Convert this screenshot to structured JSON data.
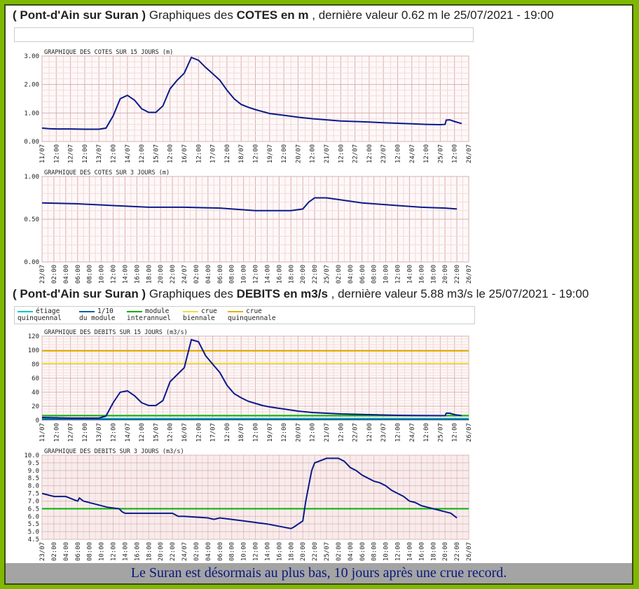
{
  "header_cotes": {
    "station": "( Pont-d'Ain sur Suran )",
    "mid": " Graphiques des ",
    "bold": "COTES en m",
    "tail": " , dernière valeur 0.62 m le 25/07/2021 - 19:00"
  },
  "header_debits": {
    "station": "( Pont-d'Ain sur Suran )",
    "mid": " Graphiques des ",
    "bold": "DEBITS en m3/s",
    "tail": " , dernière valeur 5.88 m3/s le 25/07/2021 - 19:00"
  },
  "legend": [
    {
      "l1": "étiage",
      "l2": "quinquennal",
      "color": "#00c8c8"
    },
    {
      "l1": "1/10",
      "l2": "du module",
      "color": "#0060a0"
    },
    {
      "l1": "module",
      "l2": "interannuel",
      "color": "#00b000"
    },
    {
      "l1": "crue",
      "l2": "biennale",
      "color": "#e8e040"
    },
    {
      "l1": "crue",
      "l2": "quinquennale",
      "color": "#e0b000"
    }
  ],
  "caption": "Le Suran est désormais au plus bas, 10 jours après une crue record.",
  "chart_data": [
    {
      "type": "line",
      "title": "GRAPHIQUE DES COTES SUR 15 JOURS (m)",
      "x_ticks": [
        "11/07",
        "12:00",
        "12/07",
        "12:00",
        "13/07",
        "12:00",
        "14/07",
        "12:00",
        "15/07",
        "12:00",
        "16/07",
        "12:00",
        "17/07",
        "12:00",
        "18/07",
        "12:00",
        "19/07",
        "12:00",
        "20/07",
        "12:00",
        "21/07",
        "12:00",
        "22/07",
        "12:00",
        "23/07",
        "12:00",
        "24/07",
        "12:00",
        "25/07",
        "12:00",
        "26/07"
      ],
      "y_ticks": [
        "0.00",
        "1.00",
        "2.00",
        "3.00"
      ],
      "ylim": [
        0,
        3
      ],
      "xlim": [
        0,
        360
      ],
      "x_hours": [
        0,
        6,
        12,
        24,
        36,
        48,
        54,
        60,
        66,
        72,
        78,
        84,
        90,
        96,
        102,
        108,
        114,
        120,
        126,
        132,
        138,
        144,
        150,
        156,
        162,
        168,
        174,
        180,
        186,
        192,
        204,
        216,
        228,
        240,
        252,
        264,
        276,
        288,
        300,
        312,
        324,
        336,
        340,
        341,
        344,
        348,
        354
      ],
      "values": [
        0.47,
        0.45,
        0.44,
        0.44,
        0.43,
        0.43,
        0.47,
        0.9,
        1.5,
        1.62,
        1.45,
        1.15,
        1.02,
        1.02,
        1.25,
        1.85,
        2.15,
        2.4,
        2.95,
        2.85,
        2.6,
        2.38,
        2.15,
        1.8,
        1.5,
        1.3,
        1.2,
        1.12,
        1.05,
        0.98,
        0.92,
        0.85,
        0.8,
        0.76,
        0.72,
        0.7,
        0.68,
        0.66,
        0.64,
        0.62,
        0.6,
        0.59,
        0.6,
        0.75,
        0.76,
        0.7,
        0.63
      ]
    },
    {
      "type": "line",
      "title": "GRAPHIQUE DES COTES SUR 3 JOURS (m)",
      "x_ticks": [
        "23/07",
        "02:00",
        "04:00",
        "06:00",
        "08:00",
        "10:00",
        "12:00",
        "14:00",
        "16:00",
        "18:00",
        "20:00",
        "22:00",
        "24/07",
        "02:00",
        "04:00",
        "06:00",
        "08:00",
        "10:00",
        "12:00",
        "14:00",
        "16:00",
        "18:00",
        "20:00",
        "22:00",
        "25/07",
        "02:00",
        "04:00",
        "06:00",
        "08:00",
        "10:00",
        "12:00",
        "14:00",
        "16:00",
        "18:00",
        "20:00",
        "22:00",
        "26/07"
      ],
      "y_ticks": [
        "0.00",
        "0.50",
        "1.00"
      ],
      "ylim": [
        0,
        1
      ],
      "xlim": [
        0,
        72
      ],
      "x_hours": [
        0,
        6,
        12,
        18,
        24,
        30,
        36,
        42,
        44,
        45,
        46,
        47,
        48,
        50,
        54,
        60,
        64,
        68,
        70
      ],
      "values": [
        0.69,
        0.68,
        0.66,
        0.64,
        0.64,
        0.63,
        0.6,
        0.6,
        0.62,
        0.7,
        0.75,
        0.75,
        0.75,
        0.73,
        0.69,
        0.66,
        0.64,
        0.63,
        0.62
      ]
    },
    {
      "type": "line",
      "title": "GRAPHIQUE DES DEBITS SUR 15 JOURS (m3/s)",
      "x_ticks": [
        "11/07",
        "12:00",
        "12/07",
        "12:00",
        "13/07",
        "12:00",
        "14/07",
        "12:00",
        "15/07",
        "12:00",
        "16/07",
        "12:00",
        "17/07",
        "12:00",
        "18/07",
        "12:00",
        "19/07",
        "12:00",
        "20/07",
        "12:00",
        "21/07",
        "12:00",
        "22/07",
        "12:00",
        "23/07",
        "12:00",
        "24/07",
        "12:00",
        "25/07",
        "12:00",
        "26/07"
      ],
      "y_ticks": [
        "0",
        "20",
        "40",
        "60",
        "80",
        "100",
        "120"
      ],
      "ylim": [
        0,
        120
      ],
      "xlim": [
        0,
        360
      ],
      "thresholds": [
        {
          "value": 99,
          "color": "#e0b000"
        },
        {
          "value": 81,
          "color": "#e8e040"
        },
        {
          "value": 6.5,
          "color": "#00b000"
        },
        {
          "value": 2.2,
          "color": "#00c8c8"
        },
        {
          "value": 1.2,
          "color": "#0060a0"
        }
      ],
      "x_hours": [
        0,
        12,
        24,
        36,
        48,
        54,
        60,
        66,
        72,
        78,
        84,
        90,
        96,
        102,
        108,
        114,
        120,
        126,
        132,
        138,
        144,
        150,
        156,
        162,
        168,
        174,
        180,
        186,
        192,
        204,
        216,
        228,
        240,
        252,
        264,
        276,
        288,
        300,
        312,
        324,
        336,
        340,
        341,
        344,
        348,
        354
      ],
      "values": [
        4,
        3.5,
        3,
        3,
        3,
        6,
        25,
        40,
        42,
        35,
        25,
        21,
        21,
        28,
        55,
        65,
        75,
        115,
        112,
        92,
        80,
        68,
        50,
        38,
        32,
        27,
        24,
        21,
        19,
        16,
        13,
        11,
        10,
        9,
        8.5,
        8,
        7.5,
        7,
        6.8,
        6.6,
        6.5,
        6.5,
        10,
        10,
        8,
        6.5
      ]
    },
    {
      "type": "line",
      "title": "GRAPHIQUE DES DEBITS SUR 3 JOURS (m3/s)",
      "x_ticks": [
        "23/07",
        "02:00",
        "04:00",
        "06:00",
        "08:00",
        "10:00",
        "12:00",
        "14:00",
        "16:00",
        "18:00",
        "20:00",
        "22:00",
        "24/07",
        "02:00",
        "04:00",
        "06:00",
        "08:00",
        "10:00",
        "12:00",
        "14:00",
        "16:00",
        "18:00",
        "20:00",
        "22:00",
        "25/07",
        "02:00",
        "04:00",
        "06:00",
        "08:00",
        "10:00",
        "12:00",
        "14:00",
        "16:00",
        "18:00",
        "20:00",
        "22:00",
        "26/07"
      ],
      "y_ticks": [
        "4.5",
        "5.0",
        "5.5",
        "6.0",
        "6.5",
        "7.0",
        "7.5",
        "8.0",
        "8.5",
        "9.0",
        "9.5",
        "10.0"
      ],
      "ylim": [
        4.5,
        10
      ],
      "xlim": [
        0,
        72
      ],
      "thresholds": [
        {
          "value": 6.5,
          "color": "#00b000"
        }
      ],
      "x_hours": [
        0,
        2,
        4,
        6,
        6.3,
        7,
        9,
        11,
        13,
        13.5,
        14,
        16,
        22,
        23,
        24,
        28,
        29,
        30,
        34,
        38,
        42,
        42.5,
        44,
        44.5,
        45,
        45.5,
        46,
        48,
        49,
        50,
        51,
        52,
        53,
        54,
        55,
        56,
        57,
        58,
        59,
        60,
        61,
        62,
        63,
        64,
        65,
        66,
        67,
        68,
        69,
        70
      ],
      "values": [
        7.5,
        7.3,
        7.3,
        7.0,
        7.2,
        7.0,
        6.8,
        6.6,
        6.5,
        6.3,
        6.2,
        6.2,
        6.2,
        6.0,
        6.0,
        5.9,
        5.8,
        5.9,
        5.7,
        5.5,
        5.2,
        5.3,
        5.7,
        7.0,
        8.0,
        9.0,
        9.5,
        9.8,
        9.8,
        9.8,
        9.6,
        9.2,
        9.0,
        8.7,
        8.5,
        8.3,
        8.2,
        8.0,
        7.7,
        7.5,
        7.3,
        7.0,
        6.9,
        6.7,
        6.6,
        6.5,
        6.4,
        6.3,
        6.2,
        5.9
      ]
    }
  ]
}
